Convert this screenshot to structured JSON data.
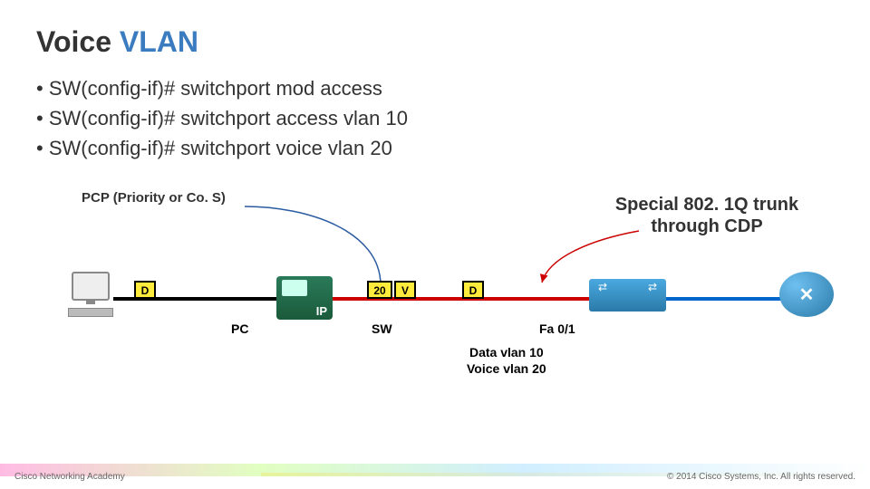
{
  "title": {
    "prefix": "Voice ",
    "highlight": "VLAN"
  },
  "bullets": [
    "SW(config-if)# switchport mod access",
    "SW(config-if)# switchport access vlan 10",
    "SW(config-if)# switchport voice vlan 20"
  ],
  "diagram": {
    "pcp_label": "PCP (Priority or Co. S)",
    "special_label": "Special 802. 1Q trunk through CDP",
    "tags": {
      "d1": "D",
      "twenty": "20",
      "v": "V",
      "d2": "D"
    },
    "labels": {
      "pc": "PC",
      "sw": "SW",
      "fa": "Fa 0/1"
    },
    "vlan_text": "Data vlan 10\nVoice vlan 20",
    "ip_label": "IP",
    "router_glyph": "✕"
  },
  "footer": {
    "left": "Cisco Networking Academy",
    "right": "© 2014 Cisco Systems, Inc. All rights reserved."
  }
}
